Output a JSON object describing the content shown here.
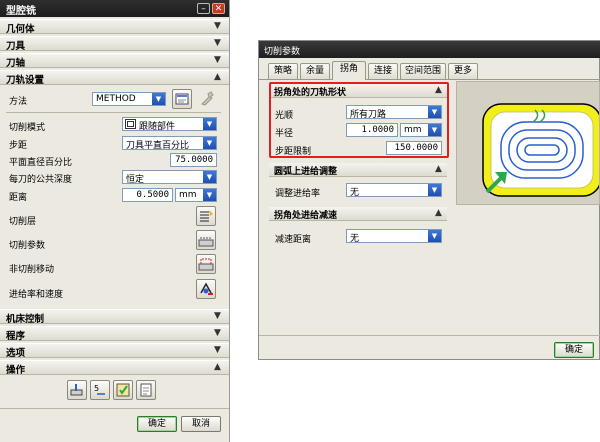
{
  "left_dialog": {
    "title": "型腔铣",
    "sections": {
      "geometry": "几何体",
      "tool": "刀具",
      "tool_axis": "刀轴",
      "path_settings": "刀轨设置",
      "machine_control": "机床控制",
      "program": "程序",
      "options": "选项",
      "actions": "操作"
    },
    "path": {
      "method_label": "方法",
      "method_value": "METHOD",
      "cut_pattern_label": "切削模式",
      "cut_pattern_value": "跟随部件",
      "stepover_label": "步距",
      "stepover_value": "刀具平直百分比",
      "flat_percent_label": "平面直径百分比",
      "flat_percent_value": "75.0000",
      "depth_label": "每刀的公共深度",
      "depth_value": "恒定",
      "distance_label": "距离",
      "distance_value": "0.5000",
      "distance_unit": "mm",
      "cut_levels_label": "切削层",
      "cut_params_label": "切削参数",
      "non_cutting_label": "非切削移动",
      "feeds_label": "进给率和速度"
    },
    "buttons": {
      "ok": "确定",
      "cancel": "取消"
    }
  },
  "right_dialog": {
    "title": "切削参数",
    "tabs": [
      "策略",
      "余量",
      "拐角",
      "连接",
      "空间范围",
      "更多"
    ],
    "active_tab": "拐角",
    "corner_shape": {
      "header": "拐角处的刀轨形状",
      "smoothing_label": "光顺",
      "smoothing_value": "所有刀路",
      "radius_label": "半径",
      "radius_value": "1.0000",
      "radius_unit": "mm",
      "step_limit_label": "步距限制",
      "step_limit_value": "150.0000"
    },
    "arc_feed": {
      "header": "圆弧上进给调整",
      "label": "调整进给率",
      "value": "无"
    },
    "corner_slow": {
      "header": "拐角处进给减速",
      "label": "减速距离",
      "value": "无"
    },
    "buttons": {
      "ok": "确定"
    }
  },
  "colors": {
    "highlight_box": "#e01f1f",
    "preview_yellow": "#f2ee1a",
    "path_blue": "#2a5fd0",
    "arrow_green": "#2aa84a"
  }
}
